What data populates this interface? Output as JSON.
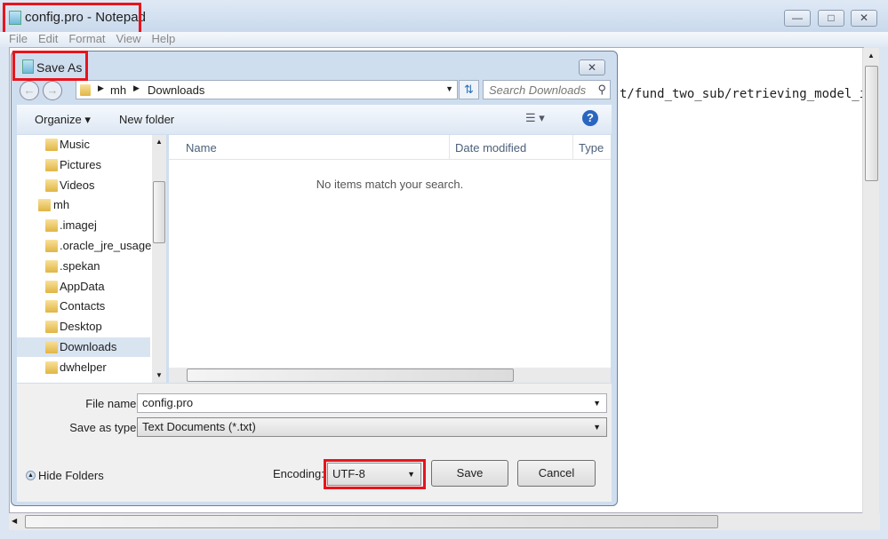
{
  "notepad": {
    "title": "config.pro - Notepad",
    "menu": [
      "File",
      "Edit",
      "Format",
      "View",
      "Help"
    ],
    "text_visible": "t/fund_two_sub/retrieving_model_i"
  },
  "dialog": {
    "title": "Save As",
    "breadcrumb": [
      "mh",
      "Downloads"
    ],
    "search_placeholder": "Search Downloads",
    "toolbar": {
      "organize": "Organize",
      "new_folder": "New folder"
    },
    "nav_items": [
      {
        "label": "Music",
        "icon": "music-icon"
      },
      {
        "label": "Pictures",
        "icon": "pictures-icon"
      },
      {
        "label": "Videos",
        "icon": "videos-icon"
      },
      {
        "label": "mh",
        "icon": "user-folder-icon"
      },
      {
        "label": ".imagej",
        "icon": "folder-icon"
      },
      {
        "label": ".oracle_jre_usage",
        "icon": "folder-icon"
      },
      {
        "label": ".spekan",
        "icon": "folder-icon"
      },
      {
        "label": "AppData",
        "icon": "folder-icon"
      },
      {
        "label": "Contacts",
        "icon": "contacts-icon"
      },
      {
        "label": "Desktop",
        "icon": "desktop-icon"
      },
      {
        "label": "Downloads",
        "icon": "downloads-icon",
        "selected": true
      },
      {
        "label": "dwhelper",
        "icon": "folder-icon"
      }
    ],
    "columns": [
      "Name",
      "Date modified",
      "Type"
    ],
    "empty_message": "No items match your search.",
    "file_name_label": "File name:",
    "file_name": "config.pro",
    "save_type_label": "Save as type:",
    "save_type": "Text Documents (*.txt)",
    "hide_folders": "Hide Folders",
    "encoding_label": "Encoding:",
    "encoding": "UTF-8",
    "save": "Save",
    "cancel": "Cancel"
  },
  "colors": {
    "highlight": "#e8141c",
    "selected": "#d9e4f1"
  }
}
